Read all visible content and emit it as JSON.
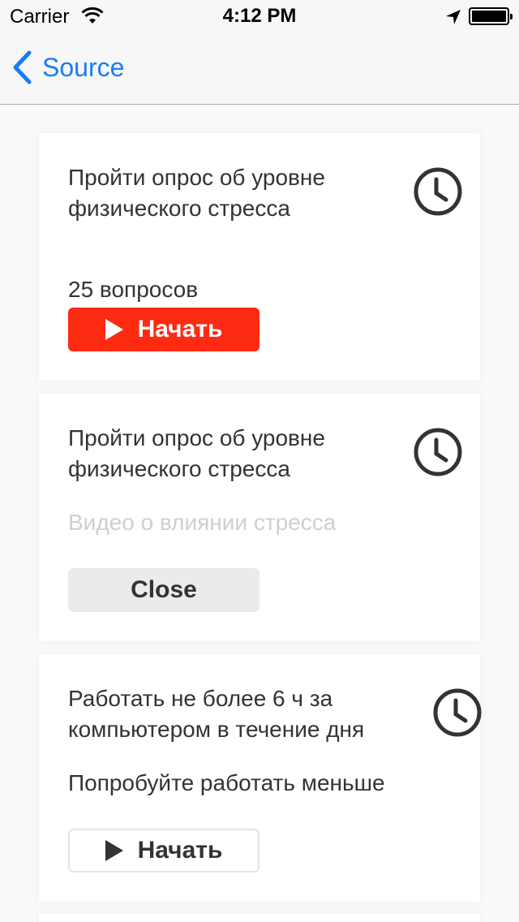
{
  "status_bar": {
    "carrier": "Carrier",
    "time": "4:12 PM"
  },
  "nav": {
    "back_label": "Source"
  },
  "cards": [
    {
      "title": "Пройти опрос об уровне физического стресса",
      "subtitle": "25 вопросов",
      "button_label": "Начать",
      "button_style": "red"
    },
    {
      "title": "Пройти опрос об уровне физического стресса",
      "subtitle": "Видео о влиянии стресса",
      "button_label": "Close",
      "button_style": "gray"
    },
    {
      "title": "Работать не более 6 ч за компьютером в течение дня",
      "subtitle": "Попробуйте работать меньше",
      "button_label": "Начать",
      "button_style": "outline"
    }
  ],
  "colors": {
    "accent_blue": "#1a7cf5",
    "start_red": "#ff2a12",
    "disabled_text": "#cfcfd2"
  }
}
